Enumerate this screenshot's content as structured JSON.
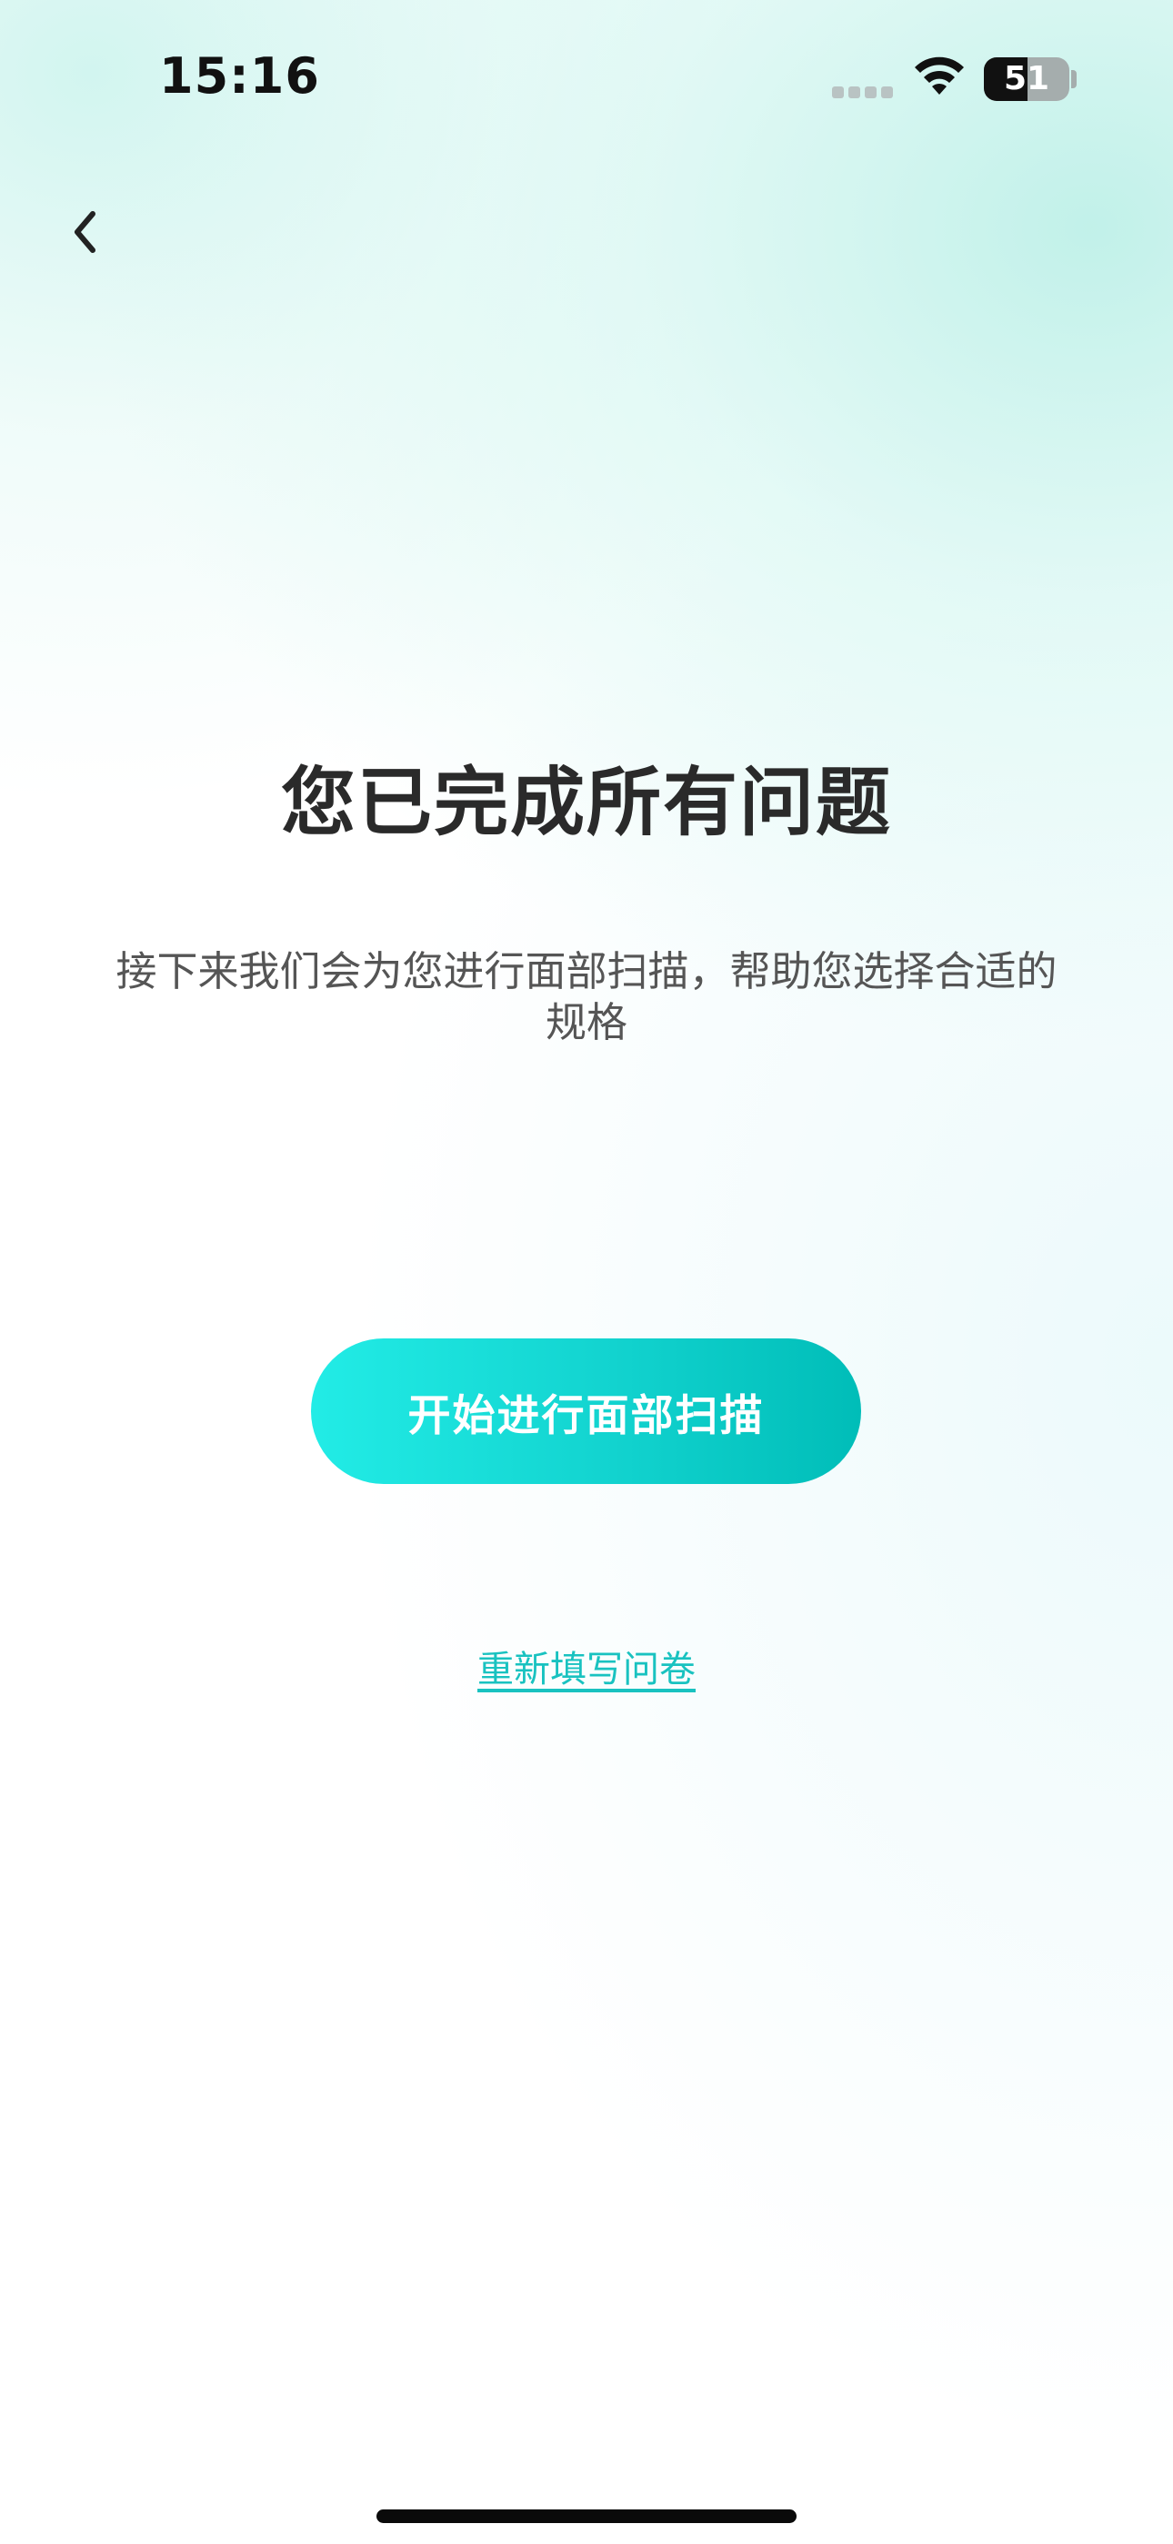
{
  "status_bar": {
    "time": "15:16",
    "battery_level": "51",
    "icons": [
      "signal-icon",
      "wifi-icon",
      "battery-icon"
    ]
  },
  "nav": {
    "back_icon": "chevron-left-icon"
  },
  "content": {
    "title": "您已完成所有问题",
    "subtitle": "接下来我们会为您进行面部扫描，帮助您选择合适的规格",
    "start_button_label": "开始进行面部扫描",
    "redo_link_label": "重新填写问卷"
  },
  "colors": {
    "accent": "#19c2c0",
    "button_gradient_start": "#22ece6",
    "button_gradient_end": "#00bdb8",
    "title_text": "#2a2a2a",
    "body_text": "#555555"
  }
}
